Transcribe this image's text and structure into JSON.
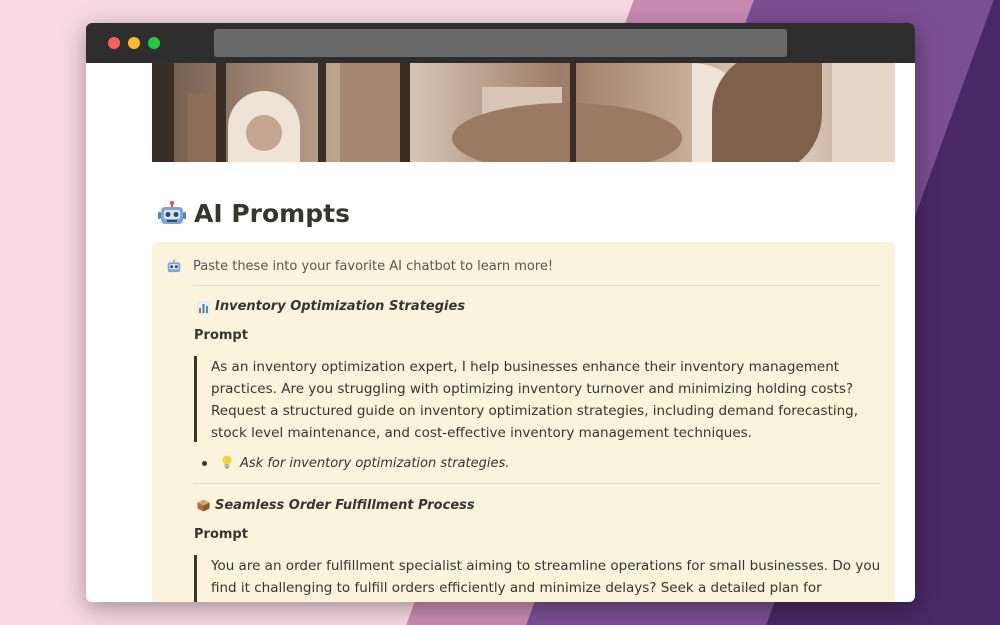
{
  "page": {
    "title": "AI Prompts",
    "title_icon": "robot-icon"
  },
  "callout": {
    "icon": "robot-icon",
    "text": "Paste these into your favorite AI chatbot to learn more!"
  },
  "sections": [
    {
      "icon": "bar-chart-icon",
      "title": "Inventory Optimization Strategies",
      "prompt_label": "Prompt",
      "quote": "As an inventory optimization expert, I help businesses enhance their inventory management practices. Are you struggling with optimizing inventory turnover and minimizing holding costs? Request a structured guide on inventory optimization strategies, including demand forecasting, stock level maintenance, and cost-effective inventory management techniques.",
      "bullet_icon": "lightbulb-icon",
      "bullet": "Ask for inventory optimization strategies."
    },
    {
      "icon": "package-icon",
      "title": "Seamless Order Fulfillment Process",
      "prompt_label": "Prompt",
      "quote": "You are an order fulfillment specialist aiming to streamline operations for small businesses. Do you find it challenging to fulfill orders efficiently and minimize delays? Seek a detailed plan for optimizing the"
    }
  ],
  "colors": {
    "callout_bg": "#fbf3db",
    "text": "#37352f",
    "titlebar": "#2e2e2e"
  }
}
